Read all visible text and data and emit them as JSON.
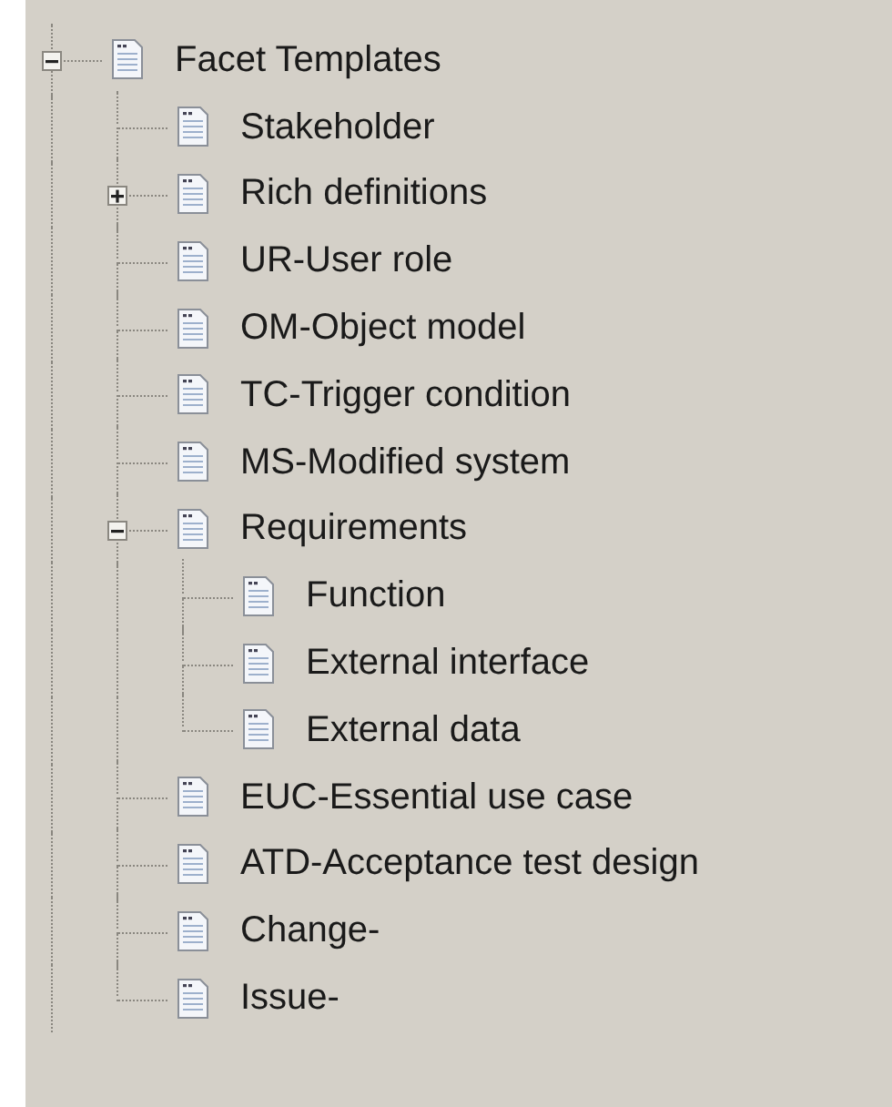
{
  "tree": {
    "nodes": [
      {
        "label": "Facet Templates",
        "expanded": true,
        "children": [
          {
            "label": "Stakeholder"
          },
          {
            "label": "Rich definitions",
            "expanded": false
          },
          {
            "label": "UR-User role"
          },
          {
            "label": "OM-Object model"
          },
          {
            "label": "TC-Trigger condition"
          },
          {
            "label": "MS-Modified system"
          },
          {
            "label": "Requirements",
            "expanded": true,
            "children": [
              {
                "label": "Function"
              },
              {
                "label": "External interface"
              },
              {
                "label": "External data"
              }
            ]
          },
          {
            "label": "EUC-Essential use case"
          },
          {
            "label": "ATD-Acceptance test design"
          },
          {
            "label": "Change-"
          },
          {
            "label": "Issue-"
          }
        ]
      }
    ]
  }
}
